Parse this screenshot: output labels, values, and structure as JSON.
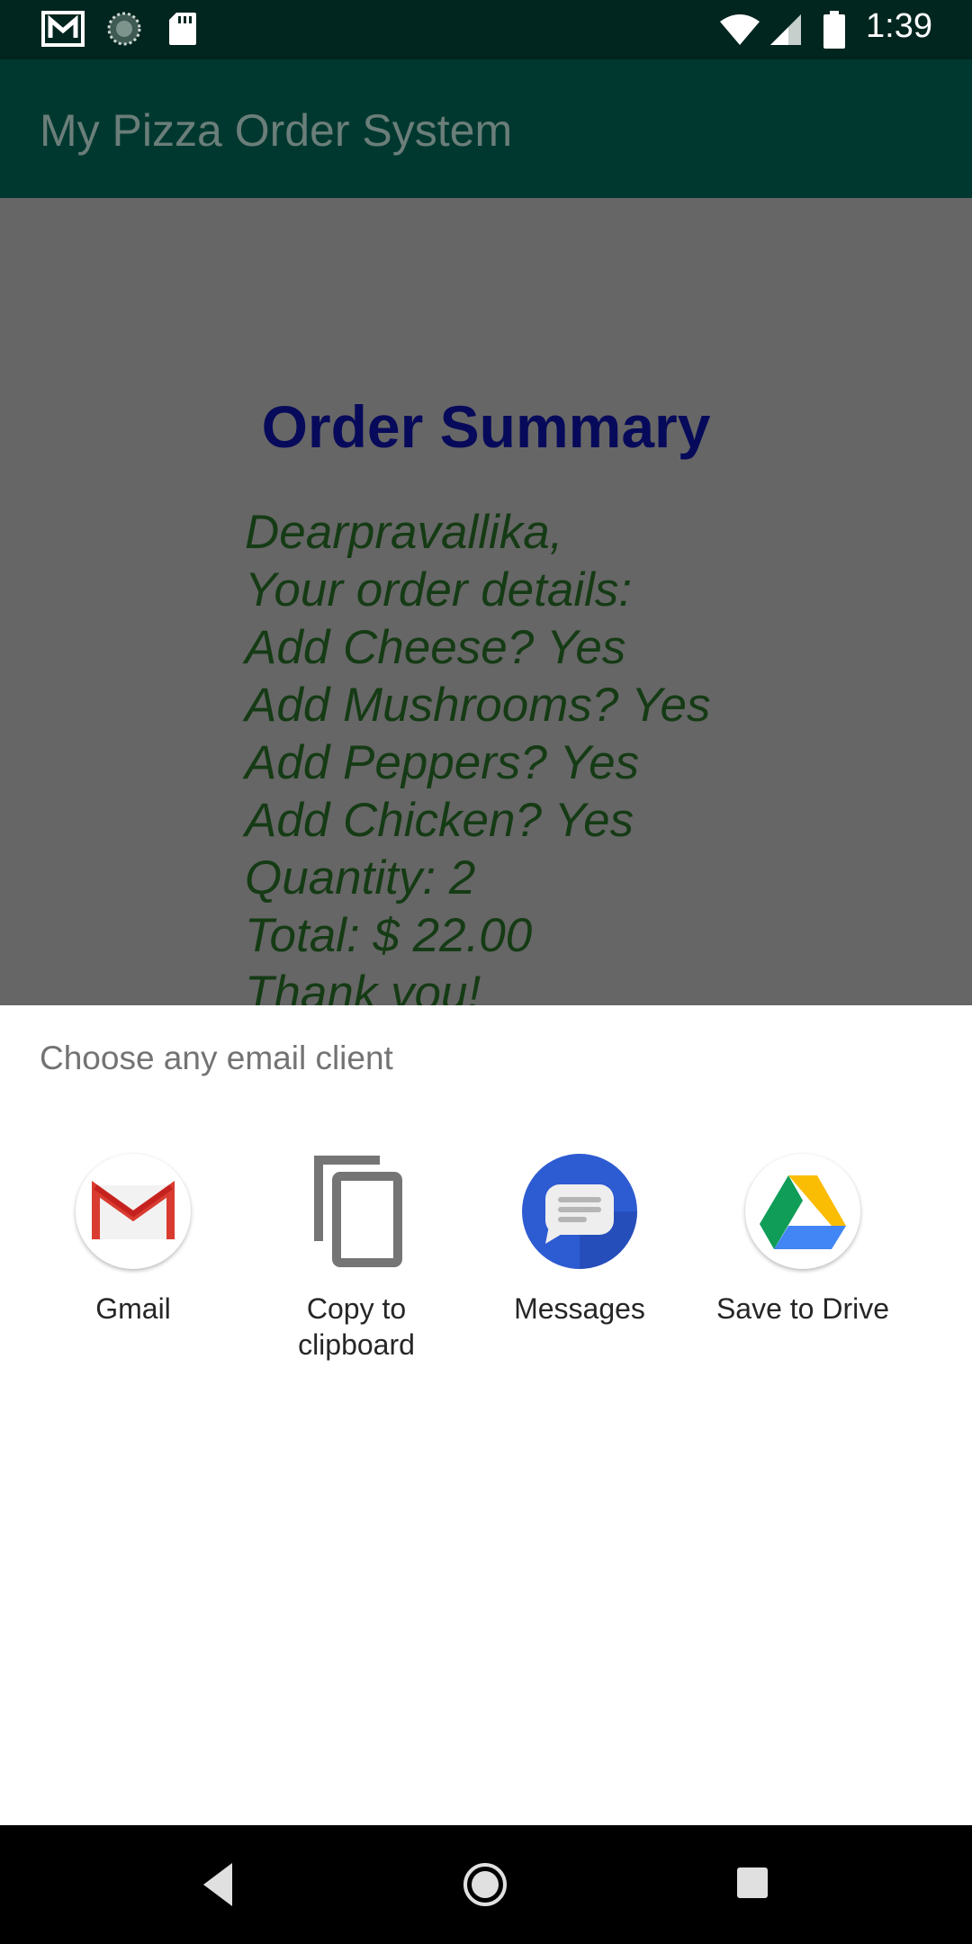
{
  "status_bar": {
    "time": "1:39",
    "left_icons": [
      "gmail-notification-icon",
      "sync-notification-icon",
      "sd-card-icon"
    ],
    "right_icons": [
      "wifi-icon",
      "cellular-signal-icon",
      "battery-icon"
    ]
  },
  "app_bar": {
    "title": "My Pizza Order System",
    "color": "#003830"
  },
  "order_summary": {
    "title": "Order Summary",
    "title_color": "#070a5a",
    "text_color": "#153b15",
    "lines": [
      "Dearpravallika,",
      "Your order details:",
      "Add Cheese? Yes",
      "Add Mushrooms? Yes",
      "Add Peppers? Yes",
      "Add Chicken? Yes",
      "Quantity: 2",
      "Total: $ 22.00",
      "Thank you!"
    ]
  },
  "chooser": {
    "title": "Choose any email client",
    "targets": [
      {
        "label": "Gmail",
        "icon": "gmail-icon"
      },
      {
        "label": "Copy to clipboard",
        "icon": "copy-icon"
      },
      {
        "label": "Messages",
        "icon": "messages-icon"
      },
      {
        "label": "Save to Drive",
        "icon": "drive-icon"
      }
    ]
  },
  "nav_bar": {
    "buttons": [
      "back-icon",
      "home-icon",
      "recents-icon"
    ]
  }
}
